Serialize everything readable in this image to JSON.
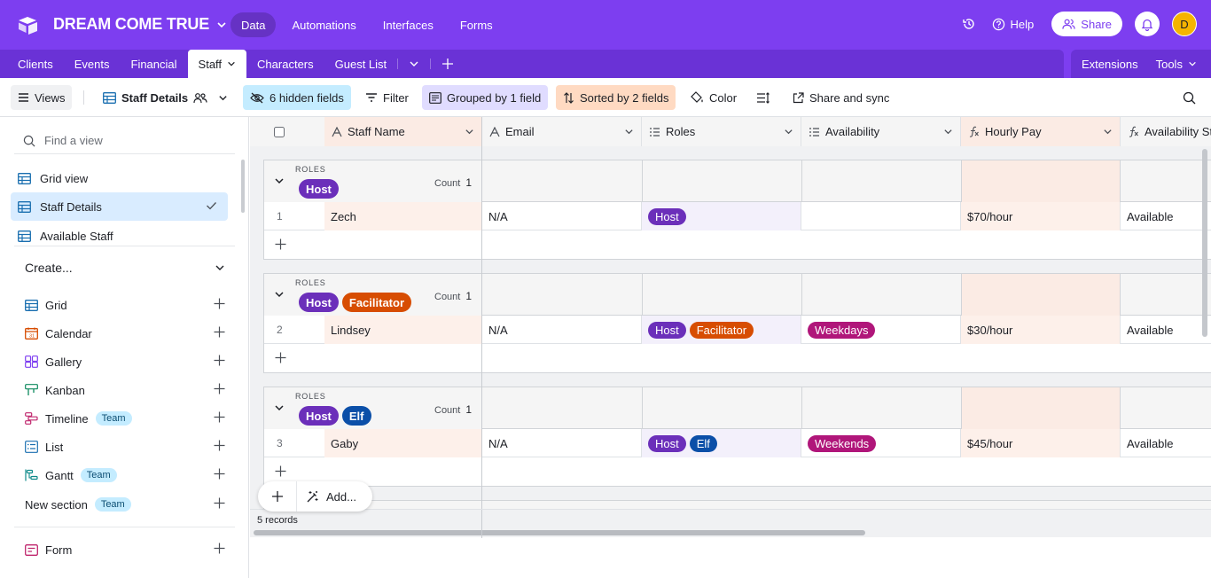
{
  "app": {
    "base_name": "DREAM COME TRUE",
    "nav": [
      "Data",
      "Automations",
      "Interfaces",
      "Forms"
    ],
    "help": "Help",
    "share": "Share",
    "avatar_initial": "D"
  },
  "tabs": {
    "items": [
      "Clients",
      "Events",
      "Financial",
      "Staff",
      "Characters",
      "Guest List"
    ],
    "active": "Staff",
    "extensions": "Extensions",
    "tools": "Tools"
  },
  "toolbar": {
    "views": "Views",
    "view_name": "Staff Details",
    "hidden_fields": "6 hidden fields",
    "filter": "Filter",
    "grouped": "Grouped by 1 field",
    "sorted": "Sorted by 2 fields",
    "color": "Color",
    "share_sync": "Share and sync"
  },
  "sidebar": {
    "find_placeholder": "Find a view",
    "views": [
      "Grid view",
      "Staff Details",
      "Available Staff"
    ],
    "create_label": "Create...",
    "create_items": [
      {
        "label": "Grid",
        "badge": ""
      },
      {
        "label": "Calendar",
        "badge": ""
      },
      {
        "label": "Gallery",
        "badge": ""
      },
      {
        "label": "Kanban",
        "badge": ""
      },
      {
        "label": "Timeline",
        "badge": "Team"
      },
      {
        "label": "List",
        "badge": ""
      },
      {
        "label": "Gantt",
        "badge": "Team"
      },
      {
        "label": "New section",
        "badge": "Team"
      }
    ],
    "form": "Form"
  },
  "grid": {
    "columns": [
      "Staff Name",
      "Email",
      "Roles",
      "Availability",
      "Hourly Pay",
      "Availability St"
    ],
    "group_label": "ROLES",
    "count_label": "Count",
    "groups": [
      {
        "chips": [
          "Host"
        ],
        "count": "1",
        "row": {
          "num": "1",
          "name": "Zech",
          "email": "N/A",
          "roles": [
            "Host"
          ],
          "availability": "",
          "pay": "$70/hour",
          "status": "Available"
        }
      },
      {
        "chips": [
          "Host",
          "Facilitator"
        ],
        "count": "1",
        "row": {
          "num": "2",
          "name": "Lindsey",
          "email": "N/A",
          "roles": [
            "Host",
            "Facilitator"
          ],
          "availability": "Weekdays",
          "pay": "$30/hour",
          "status": "Available"
        }
      },
      {
        "chips": [
          "Host",
          "Elf"
        ],
        "count": "1",
        "row": {
          "num": "3",
          "name": "Gaby",
          "email": "N/A",
          "roles": [
            "Host",
            "Elf"
          ],
          "availability": "Weekends",
          "pay": "$45/hour",
          "status": "Available"
        }
      }
    ],
    "add_label": "Add...",
    "records": "5 records"
  },
  "colors": {
    "brand": "#7d3ef0",
    "host": "#6b2fba",
    "facilitator": "#d74d02",
    "elf": "#0b4fa8",
    "weekdays": "#b0167a"
  }
}
